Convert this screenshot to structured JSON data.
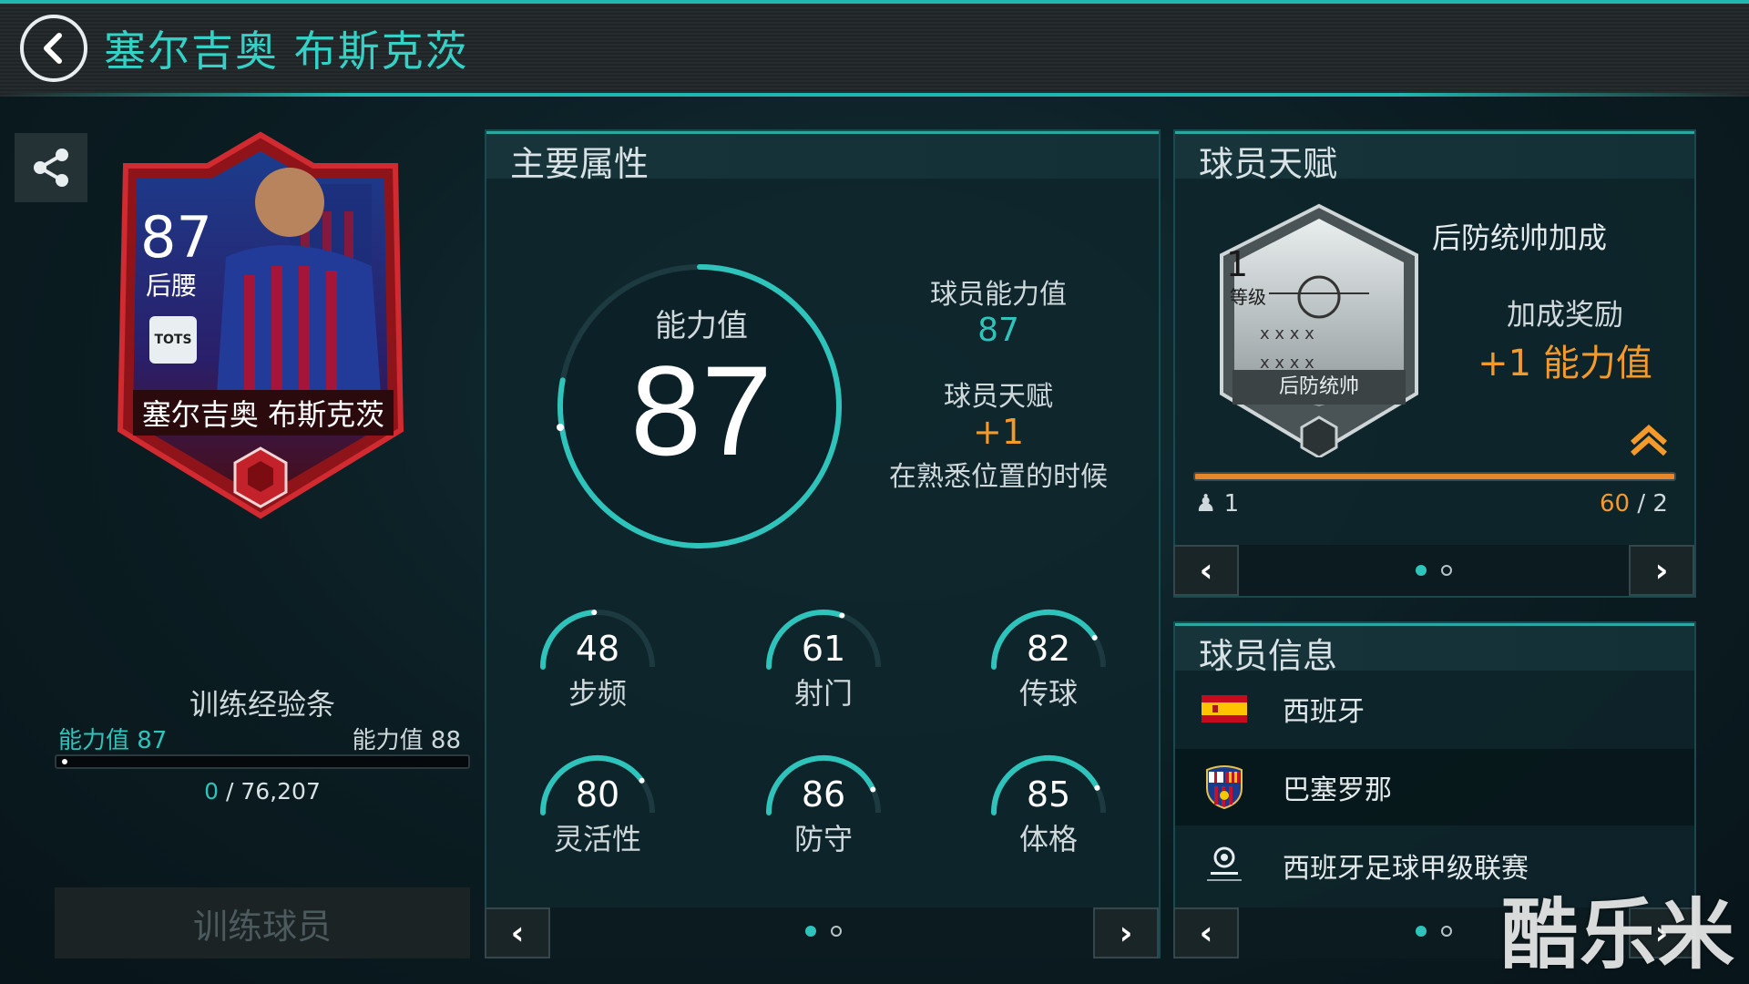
{
  "header": {
    "title": "塞尔吉奥 布斯克茨"
  },
  "card": {
    "rating": "87",
    "position": "后腰",
    "badge": "TOTS",
    "name": "塞尔吉奥 布斯克茨"
  },
  "training": {
    "title": "训练经验条",
    "left_label": "能力值 87",
    "right_label": "能力值 88",
    "current": "0",
    "separator": " / ",
    "total": "76,207",
    "progress": 0,
    "button_label": "训练球员"
  },
  "attributes": {
    "title": "主要属性",
    "overall_label": "能力值",
    "overall_value": "87",
    "player_rating_label": "球员能力值",
    "player_rating_value": "87",
    "talent_label": "球员天赋",
    "talent_value": "+1",
    "talent_condition": "在熟悉位置的时候",
    "stats": [
      {
        "value": "48",
        "label": "步频",
        "fraction": 0.48
      },
      {
        "value": "61",
        "label": "射门",
        "fraction": 0.61
      },
      {
        "value": "82",
        "label": "传球",
        "fraction": 0.82
      },
      {
        "value": "80",
        "label": "灵活性",
        "fraction": 0.8
      },
      {
        "value": "86",
        "label": "防守",
        "fraction": 0.86
      },
      {
        "value": "85",
        "label": "体格",
        "fraction": 0.85
      }
    ]
  },
  "talent": {
    "title": "球员天赋",
    "badge_level": "1",
    "badge_level_label": "等级",
    "badge_name": "后防统帅",
    "name": "后防统帅加成",
    "bonus_label": "加成奖励",
    "bonus_value": "+1 能力值",
    "level_left": "1",
    "progress_current": "60",
    "progress_sep": " / ",
    "progress_total": "2"
  },
  "info": {
    "title": "球员信息",
    "rows": [
      {
        "icon": "spain-flag-icon",
        "text": "西班牙"
      },
      {
        "icon": "barcelona-crest-icon",
        "text": "巴塞罗那"
      },
      {
        "icon": "laliga-logo-icon",
        "text": "西班牙足球甲级联赛"
      }
    ]
  },
  "watermark": "酷乐米",
  "colors": {
    "accent": "#2ec4bb",
    "orange": "#f39a2a",
    "card_red": "#a3151c"
  }
}
